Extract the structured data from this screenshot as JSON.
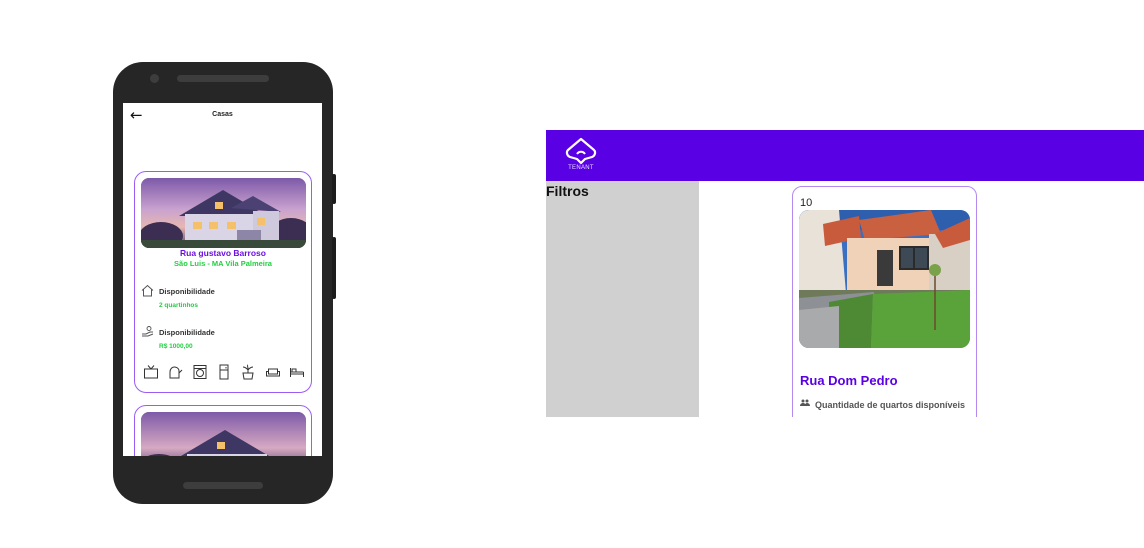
{
  "mobile": {
    "title": "Casas",
    "back_icon": "arrow-left-icon",
    "card": {
      "address_line1": "Rua gustavo Barroso",
      "address_line2": "São Luis - MA Vila Palmeira",
      "rows": [
        {
          "icon": "house-outline-icon",
          "label": "Disponibilidade",
          "value": "2 quartinhos"
        },
        {
          "icon": "hand-money-icon",
          "label": "Disponibilidade",
          "value": "R$ 1000,00"
        }
      ],
      "amenities": [
        "tv-icon",
        "kettle-icon",
        "washing-machine-icon",
        "fridge-icon",
        "plant-pot-icon",
        "sofa-icon",
        "bed-icon"
      ]
    }
  },
  "web": {
    "brand": "TENANT",
    "header_color": "#5a00e5",
    "sidebar": {
      "filters_label": "Filtros"
    },
    "card": {
      "count": "10",
      "street": "Rua Dom Pedro",
      "rooms_icon": "people-icon",
      "rooms_label": "Quantidade de quartos disponíveis"
    }
  },
  "colors": {
    "accent_purple": "#5a00e5",
    "accent_green": "#1fcf3f",
    "card_border": "#9b5cf5"
  }
}
